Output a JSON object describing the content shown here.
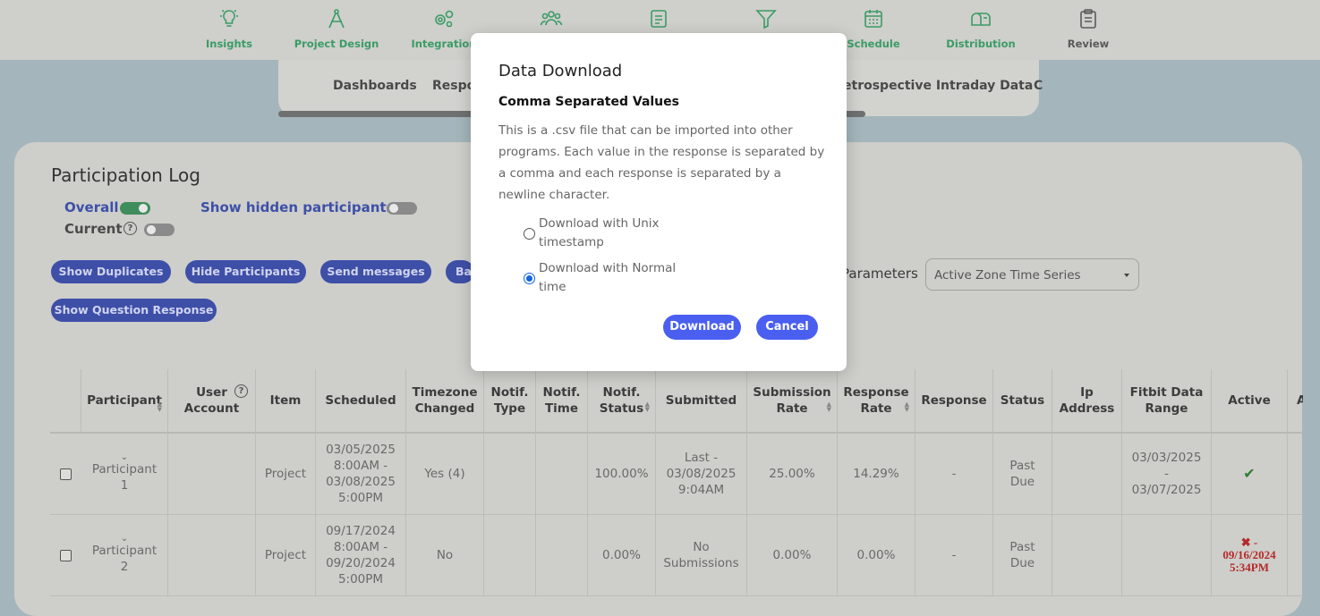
{
  "nav": {
    "items": [
      {
        "label": "Insights",
        "icon": "lightbulb-icon"
      },
      {
        "label": "Project Design",
        "icon": "compass-icon"
      },
      {
        "label": "Integration",
        "icon": "gears-icon"
      },
      {
        "label": "",
        "icon": "people-icon"
      },
      {
        "label": "",
        "icon": "document-icon"
      },
      {
        "label": "",
        "icon": "filter-icon"
      },
      {
        "label": "Schedule",
        "icon": "calendar-icon"
      },
      {
        "label": "Distribution",
        "icon": "mailbox-icon"
      },
      {
        "label": "Review",
        "icon": "clipboard-icon"
      }
    ]
  },
  "subnav": {
    "items": [
      "Dashboards",
      "Respo",
      "etrospective Intraday Data",
      "C"
    ]
  },
  "panel": {
    "title": "Participation Log",
    "overall_label": "Overall",
    "current_label": "Current",
    "hidden_label": "Show hidden participants",
    "help_glyph": "?",
    "buttons": {
      "show_duplicates": "Show Duplicates",
      "hide_participants": "Hide Participants",
      "send_messages": "Send messages",
      "ba": "Ba",
      "show_question_response": "Show Question Response"
    },
    "parameters_label": "Parameters",
    "parameters_value": "Active Zone Time Series"
  },
  "table": {
    "headers": {
      "participant": "Participant",
      "user_account_1": "User",
      "user_account_2": "Account",
      "item": "Item",
      "scheduled": "Scheduled",
      "tz_1": "Timezone",
      "tz_2": "Changed",
      "ntype_1": "Notif.",
      "ntype_2": "Type",
      "ntime_1": "Notif.",
      "ntime_2": "Time",
      "nstatus_1": "Notif.",
      "nstatus_2": "Status",
      "submitted": "Submitted",
      "srate_1": "Submission",
      "srate_2": "Rate",
      "rrate_1": "Response",
      "rrate_2": "Rate",
      "response": "Response",
      "status": "Status",
      "ip_1": "Ip",
      "ip_2": "Address",
      "fitbit_1": "Fitbit Data",
      "fitbit_2": "Range",
      "active": "Active",
      "extra": "A"
    },
    "rows": [
      {
        "participant_1": "Participant",
        "participant_2": "1",
        "item": "Project",
        "scheduled_1": "03/05/2025",
        "scheduled_2": "8:00AM -",
        "scheduled_3": "03/08/2025",
        "scheduled_4": "5:00PM",
        "tz": "Yes (4)",
        "nstatus": "100.00%",
        "submitted_1": "Last -",
        "submitted_2": "03/08/2025",
        "submitted_3": "9:04AM",
        "srate": "25.00%",
        "rrate": "14.29%",
        "response": "-",
        "status_1": "Past",
        "status_2": "Due",
        "fitbit_1": "03/03/2025",
        "fitbit_2": "-",
        "fitbit_3": "03/07/2025",
        "active": "✔"
      },
      {
        "participant_1": "Participant",
        "participant_2": "2",
        "item": "Project",
        "scheduled_1": "09/17/2024",
        "scheduled_2": "8:00AM -",
        "scheduled_3": "09/20/2024",
        "scheduled_4": "5:00PM",
        "tz": "No",
        "nstatus": "0.00%",
        "submitted_1": "No",
        "submitted_2": "Submissions",
        "srate": "0.00%",
        "rrate": "0.00%",
        "response": "-",
        "status_1": "Past",
        "status_2": "Due",
        "active_1": "✖ -",
        "active_2": "09/16/2024",
        "active_3": "5:34PM"
      }
    ]
  },
  "modal": {
    "title": "Data Download",
    "subtitle": "Comma Separated Values",
    "description": "This is a .csv file that can be imported into other programs. Each value in the response is separated by a comma and each response is separated by a newline character.",
    "option_unix_1": "Download with Unix",
    "option_unix_2": "timestamp",
    "option_normal_1": "Download with Normal",
    "option_normal_2": "time",
    "selected_option": "normal",
    "download_label": "Download",
    "cancel_label": "Cancel"
  },
  "colors": {
    "accent_green": "#3a9c66",
    "button_blue": "#3e4fa8",
    "modal_button": "#4a5ff0",
    "radio_selected": "#1565e0"
  }
}
